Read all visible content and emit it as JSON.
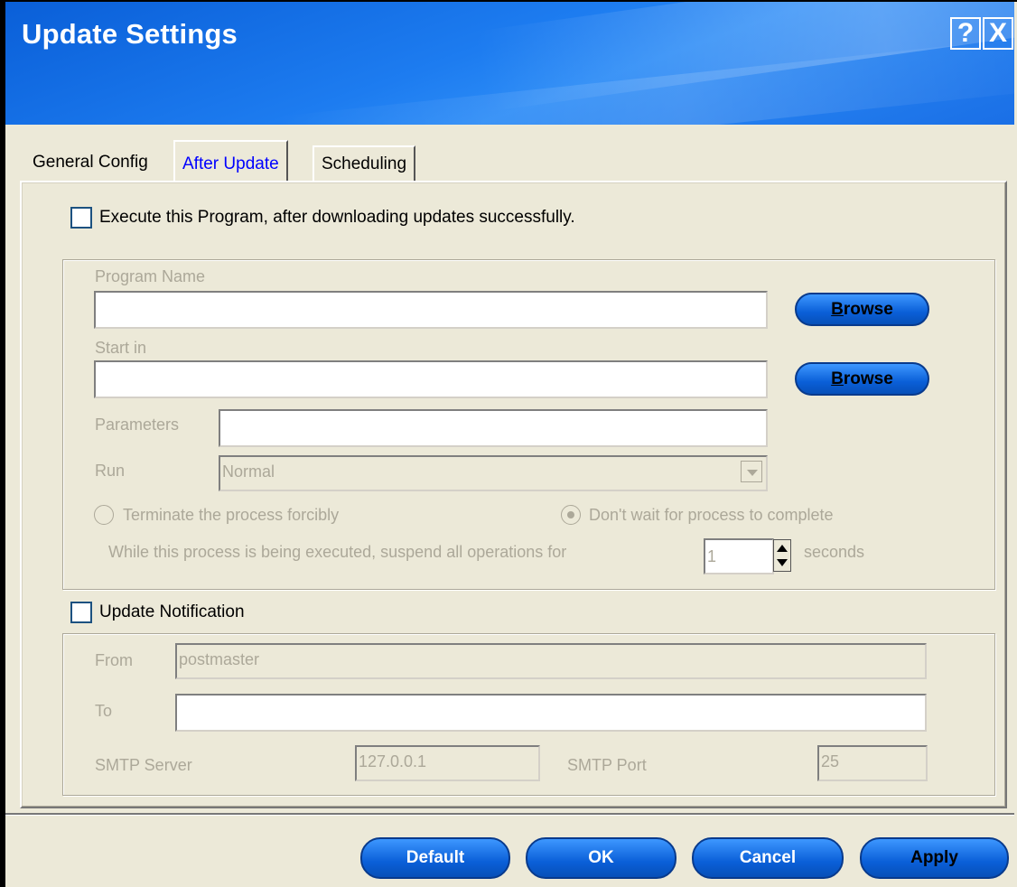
{
  "window": {
    "title": "Update Settings",
    "help_label": "?",
    "close_label": "X"
  },
  "tabs": [
    {
      "label": "General Config"
    },
    {
      "label": "After Update"
    },
    {
      "label": "Scheduling"
    }
  ],
  "execute": {
    "checkbox_label": "Execute this Program, after downloading updates successfully.",
    "program_name_label": "Program Name",
    "program_name_value": "",
    "start_in_label": "Start in",
    "start_in_value": "",
    "browse_label_ul": "B",
    "browse_label_rest": "rowse",
    "parameters_label": "Parameters",
    "parameters_value": "",
    "run_label": "Run",
    "run_value": "Normal",
    "terminate_label": "Terminate the process forcibly",
    "dont_wait_label": "Don't wait for process to complete",
    "suspend_label": "While this process is being executed, suspend all operations for",
    "suspend_value": "1",
    "seconds_label": "seconds"
  },
  "notification": {
    "checkbox_label": "Update Notification",
    "from_label": "From",
    "from_value": "postmaster",
    "to_label": "To",
    "to_value": "",
    "smtp_server_label": "SMTP Server",
    "smtp_server_value": "127.0.0.1",
    "smtp_port_label": "SMTP Port",
    "smtp_port_value": "25"
  },
  "buttons": {
    "default": "Default",
    "ok": "OK",
    "cancel": "Cancel",
    "apply": "Apply"
  }
}
